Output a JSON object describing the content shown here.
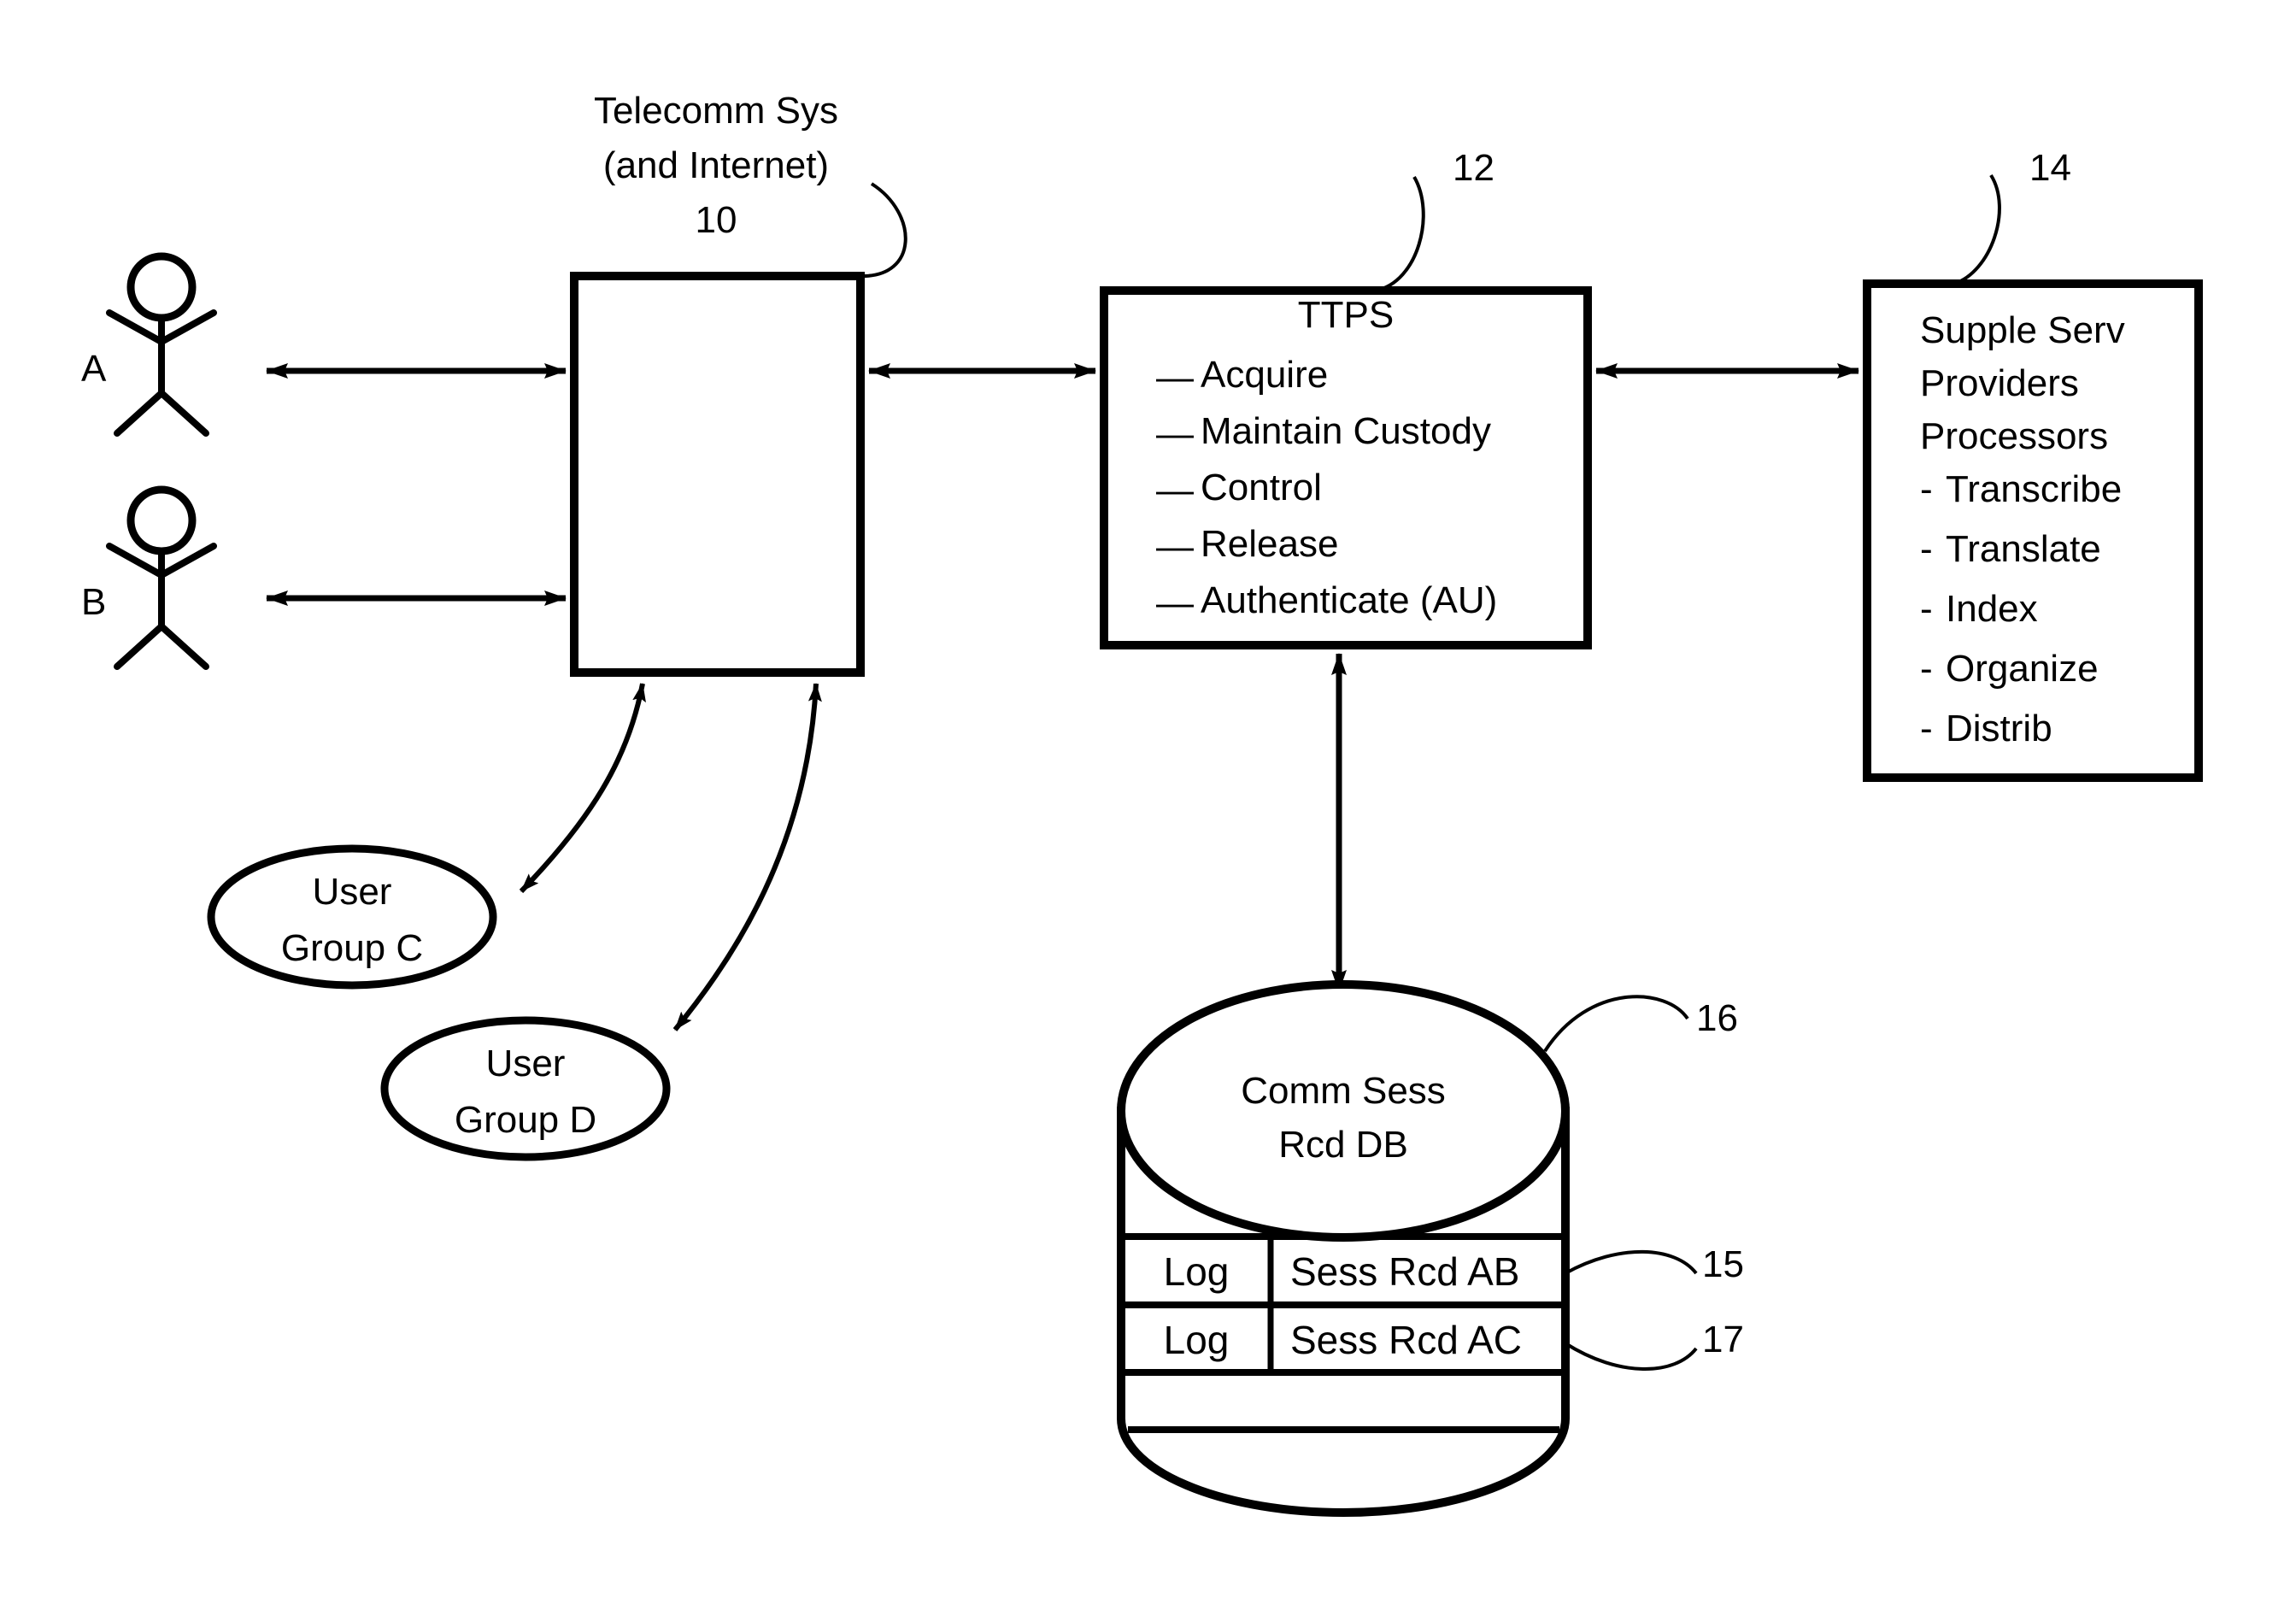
{
  "figure": {
    "domain": "patent-diagram",
    "stroke_color": "#000000",
    "background_color": "#ffffff"
  },
  "actors": [
    {
      "id": "A",
      "label": "A",
      "name": "stick-figure-a"
    },
    {
      "id": "B",
      "label": "B",
      "name": "stick-figure-b"
    }
  ],
  "telecom": {
    "title_line1": "Telecomm Sys",
    "title_line2": "(and Internet)",
    "ref": "10"
  },
  "ttps": {
    "title": "TTPS",
    "ref": "12",
    "items": [
      "Acquire",
      "Maintain Custody",
      "Control",
      "Release",
      "Authenticate (AU)"
    ],
    "bullet": "—"
  },
  "supple": {
    "ref": "14",
    "heading": [
      "Supple Serv",
      "Providers",
      "Processors"
    ],
    "items": [
      "Transcribe",
      "Translate",
      "Index",
      "Organize",
      "Distrib"
    ],
    "bullet": "-"
  },
  "user_groups": [
    {
      "line1": "User",
      "line2": "Group C",
      "name": "user-group-c"
    },
    {
      "line1": "User",
      "line2": "Group D",
      "name": "user-group-d"
    }
  ],
  "database": {
    "title_line1": "Comm Sess",
    "title_line2": "Rcd DB",
    "ref": "16",
    "rows": [
      {
        "log": "Log",
        "record": "Sess Rcd AB",
        "ref": "15"
      },
      {
        "log": "Log",
        "record": "Sess Rcd AC",
        "ref": "17"
      }
    ]
  }
}
